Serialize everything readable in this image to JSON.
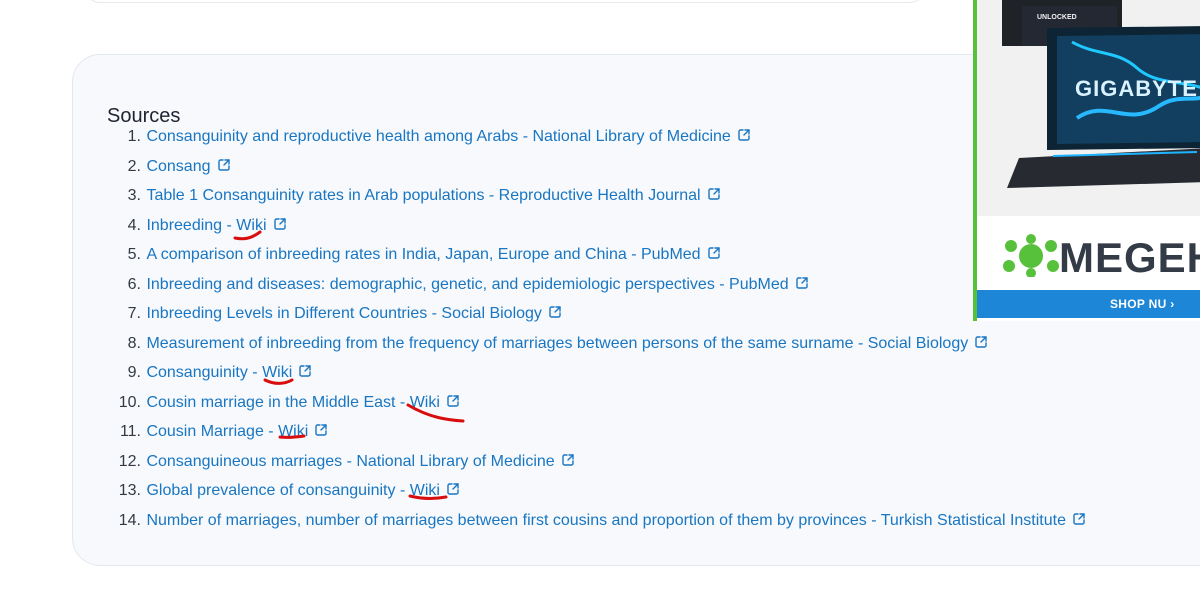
{
  "sources": {
    "title": "Sources",
    "items": [
      {
        "number": "1.",
        "text": "Consanguinity and reproductive health among Arabs - National Library of Medicine",
        "wiki": ""
      },
      {
        "number": "2.",
        "text": "Consang",
        "wiki": ""
      },
      {
        "number": "3.",
        "text": "Table 1 Consanguinity rates in Arab populations - Reproductive Health Journal",
        "wiki": ""
      },
      {
        "number": "4.",
        "text": "Inbreeding - ",
        "wiki": "Wiki"
      },
      {
        "number": "5.",
        "text": "A comparison of inbreeding rates in India, Japan, Europe and China - PubMed",
        "wiki": ""
      },
      {
        "number": "6.",
        "text": "Inbreeding and diseases: demographic, genetic, and epidemiologic perspectives - PubMed",
        "wiki": ""
      },
      {
        "number": "7.",
        "text": "Inbreeding Levels in Different Countries - Social Biology",
        "wiki": ""
      },
      {
        "number": "8.",
        "text": "Measurement of inbreeding from the frequency of marriages between persons of the same surname - Social Biology",
        "wiki": ""
      },
      {
        "number": "9.",
        "text": "Consanguinity - ",
        "wiki": "Wiki"
      },
      {
        "number": "10.",
        "text": "Cousin marriage in the Middle East - ",
        "wiki": "Wiki"
      },
      {
        "number": "11.",
        "text": "Cousin Marriage - ",
        "wiki": "Wiki"
      },
      {
        "number": "12.",
        "text": "Consanguineous marriages - National Library of Medicine",
        "wiki": ""
      },
      {
        "number": "13.",
        "text": "Global prevalence of consanguinity - ",
        "wiki": "Wiki"
      },
      {
        "number": "14.",
        "text": "Number of marriages, number of marriages between first cousins and proportion of them by provinces - Turkish Statistical Institute",
        "wiki": ""
      }
    ],
    "icon": "external-link-icon"
  },
  "ad": {
    "brand_text": "MEGEH",
    "shop_button": "SHOP NU ›",
    "image_text": "GIGABYTE",
    "image_badge": "UNLOCKED",
    "brand_icon": "frog-logo-icon",
    "colors": {
      "accent": "#58c13c",
      "shop_bar": "#1d86d6"
    }
  },
  "colors": {
    "link": "#1976c2",
    "annotation": "#d80d0d",
    "card_background": "#f7f9fc"
  }
}
